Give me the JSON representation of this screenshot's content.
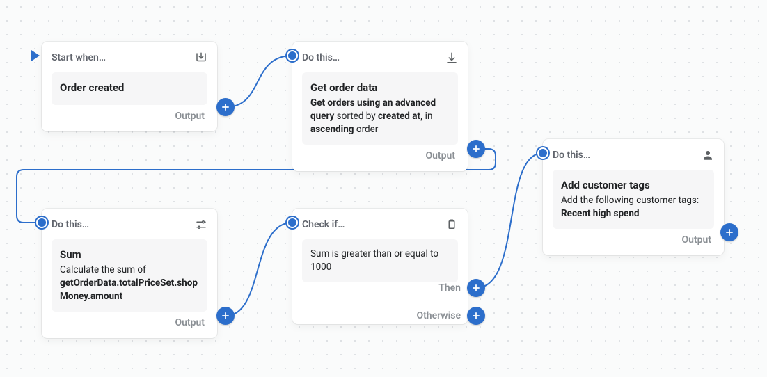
{
  "nodes": {
    "n1": {
      "header": "Start when…",
      "body_title": "Order created",
      "output_label": "Output"
    },
    "n2": {
      "header": "Do this…",
      "body_title": "Get order data",
      "desc_prefix": "Get orders using an advanced query",
      "desc_mid1": " sorted by ",
      "desc_b2": "created at,",
      "desc_mid2": " in ",
      "desc_b3": "ascending",
      "desc_suffix": " order",
      "output_label": "Output"
    },
    "n3": {
      "header": "Do this…",
      "body_title": "Sum",
      "desc_plain": "Calculate the sum of ",
      "desc_bold": "getOrderData.totalPriceSet.shopMoney.amount",
      "output_label": "Output"
    },
    "n4": {
      "header": "Check if…",
      "body_text": "Sum is greater than or equal to 1000",
      "then_label": "Then",
      "otherwise_label": "Otherwise"
    },
    "n5": {
      "header": "Do this…",
      "body_title": "Add customer tags",
      "desc_plain": "Add the following customer tags: ",
      "desc_bold": "Recent high spend",
      "output_label": "Output"
    }
  }
}
